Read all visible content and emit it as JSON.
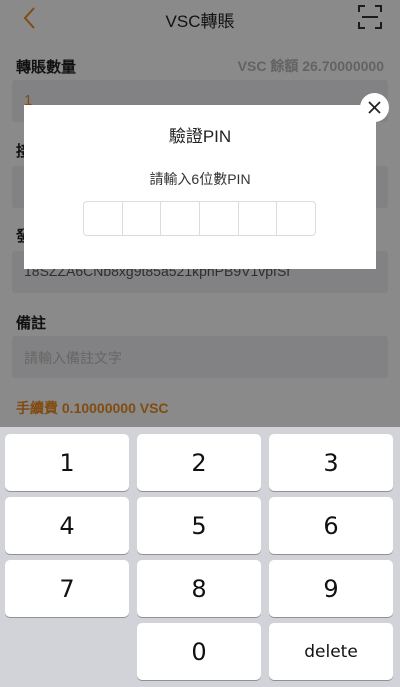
{
  "navbar": {
    "title": "VSC轉賬",
    "back_icon": "chevron-left-icon",
    "scan_icon": "scan-icon",
    "accent_color": "#ee8c22"
  },
  "form": {
    "amount_label": "轉賬數量",
    "balance_text": "VSC 餘額 26.70000000",
    "amount_value": "1",
    "row2_label_partial": "接",
    "row3_label_partial": "發",
    "address_value": "18SZZA6CNb8xg9t85a521kphPB9V1vpfSf",
    "memo_label": "備註",
    "memo_placeholder": "請輸入備註文字",
    "fee_text": "手續費 0.10000000 VSC"
  },
  "pin_dialog": {
    "title": "驗證PIN",
    "subtitle": "請輸入6位數PIN",
    "digit_count": 6,
    "close_icon": "close-icon"
  },
  "keypad": {
    "keys": [
      "1",
      "2",
      "3",
      "4",
      "5",
      "6",
      "7",
      "8",
      "9",
      "",
      "0",
      "delete"
    ]
  }
}
